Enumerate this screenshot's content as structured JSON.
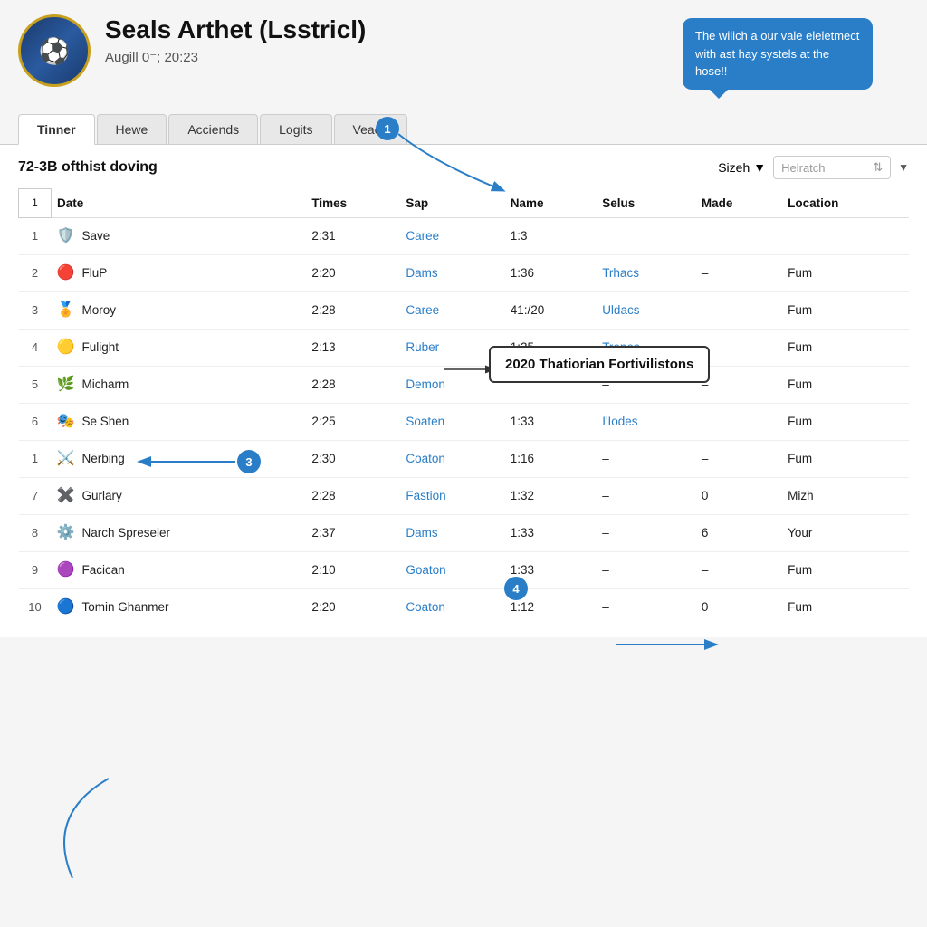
{
  "window": {
    "close_label": "✕"
  },
  "header": {
    "title": "Seals Arthet (Lsstricl)",
    "subtitle": "Augill 0⁻; 20:23",
    "logo_emoji": "⚽"
  },
  "tooltip": {
    "text": "The wilich a our vale eleletmect with ast hay systels at the hose!!"
  },
  "tabs": [
    {
      "label": "Tinner",
      "active": true
    },
    {
      "label": "Hewe",
      "active": false
    },
    {
      "label": "Acciends",
      "active": false
    },
    {
      "label": "Logits",
      "active": false
    },
    {
      "label": "Veaen",
      "active": false
    }
  ],
  "table_section": {
    "title": "72-3B ofthist doving",
    "filter_label": "Sizeh",
    "search_placeholder": "Helratch",
    "page_number": "1"
  },
  "columns": [
    "",
    "Date",
    "Times",
    "Sap",
    "Name",
    "Selus",
    "Made",
    "Location"
  ],
  "popup": "2020 Thatiorian Fortivilistons",
  "rows": [
    {
      "num": "1",
      "date": "Save",
      "times": "2:31",
      "sap": "Caree",
      "name": "1:3",
      "selus": "",
      "made": "",
      "location": "",
      "sap_link": true,
      "selus_link": false
    },
    {
      "num": "2",
      "date": "FluP",
      "times": "2:20",
      "sap": "Dams",
      "name": "1:36",
      "selus": "Trhacs",
      "made": "–",
      "location": "Fum",
      "sap_link": true,
      "selus_link": true
    },
    {
      "num": "3",
      "date": "Moroy",
      "times": "2:28",
      "sap": "Caree",
      "name": "41:/20",
      "selus": "Uldacs",
      "made": "–",
      "location": "Fum",
      "sap_link": true,
      "selus_link": true
    },
    {
      "num": "4",
      "date": "Fulight",
      "times": "2:13",
      "sap": "Ruber",
      "name": "1:35",
      "selus": "Tropes",
      "made": "–",
      "location": "Fum",
      "sap_link": true,
      "selus_link": true
    },
    {
      "num": "5",
      "date": "Micharm",
      "times": "2:28",
      "sap": "Demon",
      "name": "",
      "selus": "–",
      "made": "–",
      "location": "Fum",
      "sap_link": true,
      "selus_link": false
    },
    {
      "num": "6",
      "date": "Se Shen",
      "times": "2:25",
      "sap": "Soaten",
      "name": "1:33",
      "selus": "I'Iodes",
      "made": "",
      "location": "Fum",
      "sap_link": true,
      "selus_link": true
    },
    {
      "num": "1",
      "date": "Nerbing",
      "times": "2:30",
      "sap": "Coaton",
      "name": "1:16",
      "selus": "–",
      "made": "–",
      "location": "Fum",
      "sap_link": true,
      "selus_link": false
    },
    {
      "num": "7",
      "date": "Gurlary",
      "times": "2:28",
      "sap": "Fastion",
      "name": "1:32",
      "selus": "–",
      "made": "0",
      "location": "Mizh",
      "sap_link": true,
      "selus_link": false
    },
    {
      "num": "8",
      "date": "Narch Spreseler",
      "times": "2:37",
      "sap": "Dams",
      "name": "1:33",
      "selus": "–",
      "made": "6",
      "location": "Your",
      "sap_link": true,
      "selus_link": false
    },
    {
      "num": "9",
      "date": "Facican",
      "times": "2:10",
      "sap": "Goaton",
      "name": "1:33",
      "selus": "–",
      "made": "–",
      "location": "Fum",
      "sap_link": true,
      "selus_link": false
    },
    {
      "num": "10",
      "date": "Tomin Ghanmer",
      "times": "2:20",
      "sap": "Coaton",
      "name": "1:12",
      "selus": "–",
      "made": "0",
      "location": "Fum",
      "sap_link": true,
      "selus_link": false
    }
  ],
  "team_icons": [
    "🛡",
    "🔴",
    "🏆",
    "🟡",
    "🌿",
    "🎭",
    "⚔",
    "✖",
    "⚙",
    "🟣",
    "🔵"
  ]
}
